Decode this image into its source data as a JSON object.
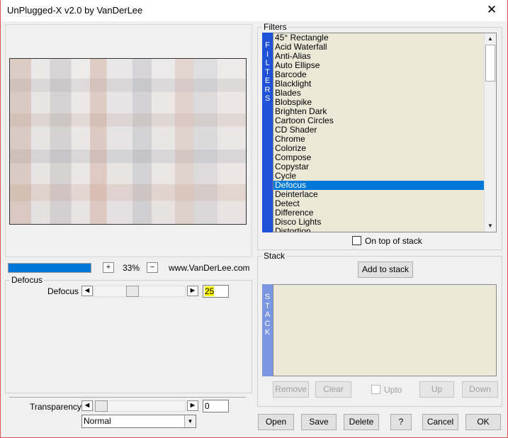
{
  "window": {
    "title": "UnPlugged-X v2.0 by VanDerLee",
    "close_glyph": "✕"
  },
  "preview": {
    "image_description_icon": "preview-image"
  },
  "zoom": {
    "progress_fraction": 1.0,
    "plus": "+",
    "value": "33%",
    "minus": "−",
    "website": "www.VanDerLee.com"
  },
  "defocus_group": {
    "label": "Defocus",
    "param_label": "Defocus",
    "value": "25",
    "left_arrow": "◄",
    "right_arrow": "►",
    "slider_fraction": 0.4
  },
  "transparency": {
    "label": "Transparency",
    "value": "0",
    "left_arrow": "◄",
    "right_arrow": "►",
    "slider_fraction": 0.0,
    "blend_mode": "Normal",
    "dropdown_arrow": "▼"
  },
  "filters": {
    "group_label": "Filters",
    "vertical_label": [
      "F",
      "I",
      "L",
      "T",
      "E",
      "R",
      "S"
    ],
    "items": [
      "45° Rectangle",
      "Acid Waterfall",
      "Anti-Alias",
      "Auto Ellipse",
      "Barcode",
      "Blacklight",
      "Blades",
      "Blobspike",
      "Brighten Dark",
      "Cartoon Circles",
      "CD Shader",
      "Chrome",
      "Colorize",
      "Compose",
      "Copystar",
      "Cycle",
      "Defocus",
      "Deinterlace",
      "Detect",
      "Difference",
      "Disco Lights",
      "Distortion"
    ],
    "selected_index": 16,
    "on_top_label": "On top of stack",
    "scroll_up": "▲",
    "scroll_down": "▼"
  },
  "stack": {
    "group_label": "Stack",
    "add_button": "Add to stack",
    "vertical_label": [
      "S",
      "T",
      "A",
      "C",
      "K"
    ],
    "remove": "Remove",
    "clear": "Clear",
    "upto": "Upto",
    "up": "Up",
    "down": "Down"
  },
  "buttons": {
    "open": "Open",
    "save": "Save",
    "delete": "Delete",
    "help": "?",
    "cancel": "Cancel",
    "ok": "OK"
  },
  "colors": {
    "accent": "#0078d7",
    "tab_blue": "#1f52d6",
    "stack_tab": "#7a96e0",
    "highlight_value": "#ffff00"
  }
}
